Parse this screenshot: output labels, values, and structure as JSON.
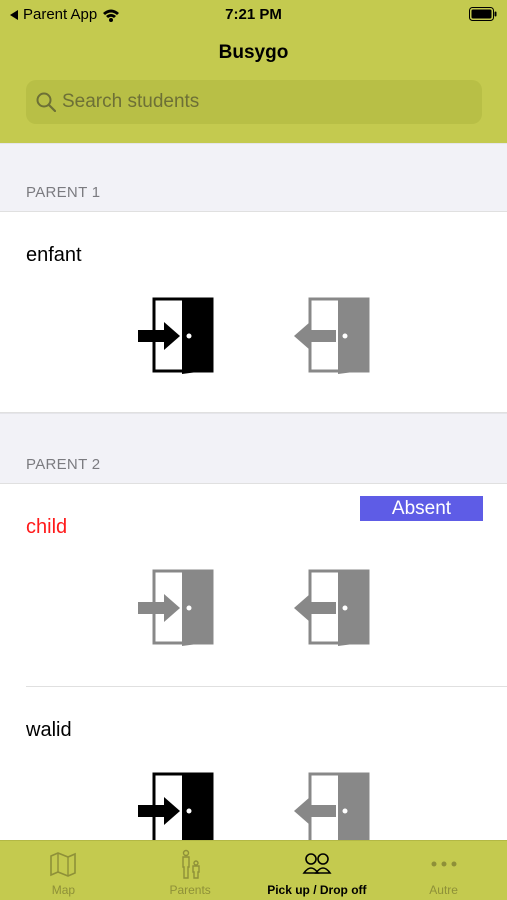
{
  "status_bar": {
    "back_app": "Parent App",
    "time": "7:21 PM"
  },
  "nav": {
    "title": "Busygo"
  },
  "search": {
    "placeholder": "Search students"
  },
  "sections": [
    {
      "label": "PARENT 1",
      "students": [
        {
          "name": "enfant",
          "dropoff_active": true,
          "pickup_active": false
        }
      ]
    },
    {
      "label": "PARENT 2",
      "students": [
        {
          "name": "child",
          "status_badge": "Absent",
          "dropoff_active": false,
          "pickup_active": false,
          "name_color": "#ff1a1a"
        },
        {
          "name": "walid",
          "dropoff_active": true,
          "pickup_active": false
        }
      ]
    }
  ],
  "tabbar": {
    "tabs": [
      {
        "label": "Map",
        "icon": "map-icon",
        "active": false
      },
      {
        "label": "Parents",
        "icon": "parent-child-icon",
        "active": false
      },
      {
        "label": "Pick up / Drop off",
        "icon": "students-icon",
        "active": true
      },
      {
        "label": "Autre",
        "icon": "more-icon",
        "active": false
      }
    ]
  },
  "colors": {
    "brand": "#c4ca4f",
    "badge": "#5e5ce6",
    "absent_text": "#ff1a1a",
    "inactive_icon": "#888888"
  }
}
